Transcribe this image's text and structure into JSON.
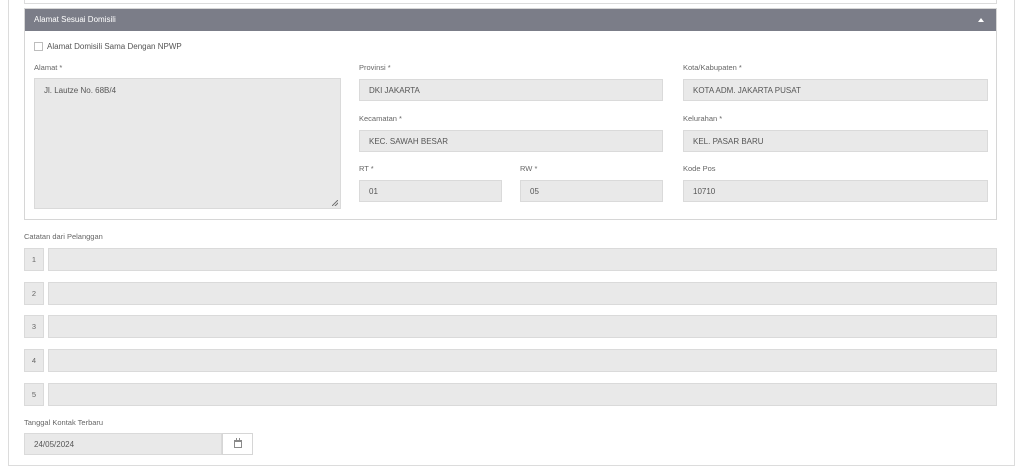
{
  "address_panel": {
    "title": "Alamat Sesuai Domisili",
    "same_as_npwp_label": "Alamat Domisili Sama Dengan NPWP",
    "same_as_npwp_checked": false,
    "alamat": {
      "label": "Alamat *",
      "value": "Jl. Lautze No. 68B/4"
    },
    "provinsi": {
      "label": "Provinsi *",
      "value": "DKI JAKARTA"
    },
    "kota": {
      "label": "Kota/Kabupaten *",
      "value": "KOTA ADM. JAKARTA PUSAT"
    },
    "kecamatan": {
      "label": "Kecamatan *",
      "value": "KEC. SAWAH BESAR"
    },
    "kelurahan": {
      "label": "Kelurahan *",
      "value": "KEL. PASAR BARU"
    },
    "rt": {
      "label": "RT *",
      "value": "01"
    },
    "rw": {
      "label": "RW *",
      "value": "05"
    },
    "kode_pos": {
      "label": "Kode Pos",
      "value": "10710"
    }
  },
  "notes": {
    "label": "Catatan dari Pelanggan",
    "rows": [
      {
        "num": "1",
        "value": ""
      },
      {
        "num": "2",
        "value": ""
      },
      {
        "num": "3",
        "value": ""
      },
      {
        "num": "4",
        "value": ""
      },
      {
        "num": "5",
        "value": ""
      }
    ]
  },
  "last_contact": {
    "label": "Tanggal Kontak Terbaru",
    "value": "24/05/2024",
    "icon": "calendar-icon"
  },
  "colors": {
    "panel_header": "#7b7d88",
    "field_bg": "#e9e9e9",
    "border": "#dadada"
  }
}
